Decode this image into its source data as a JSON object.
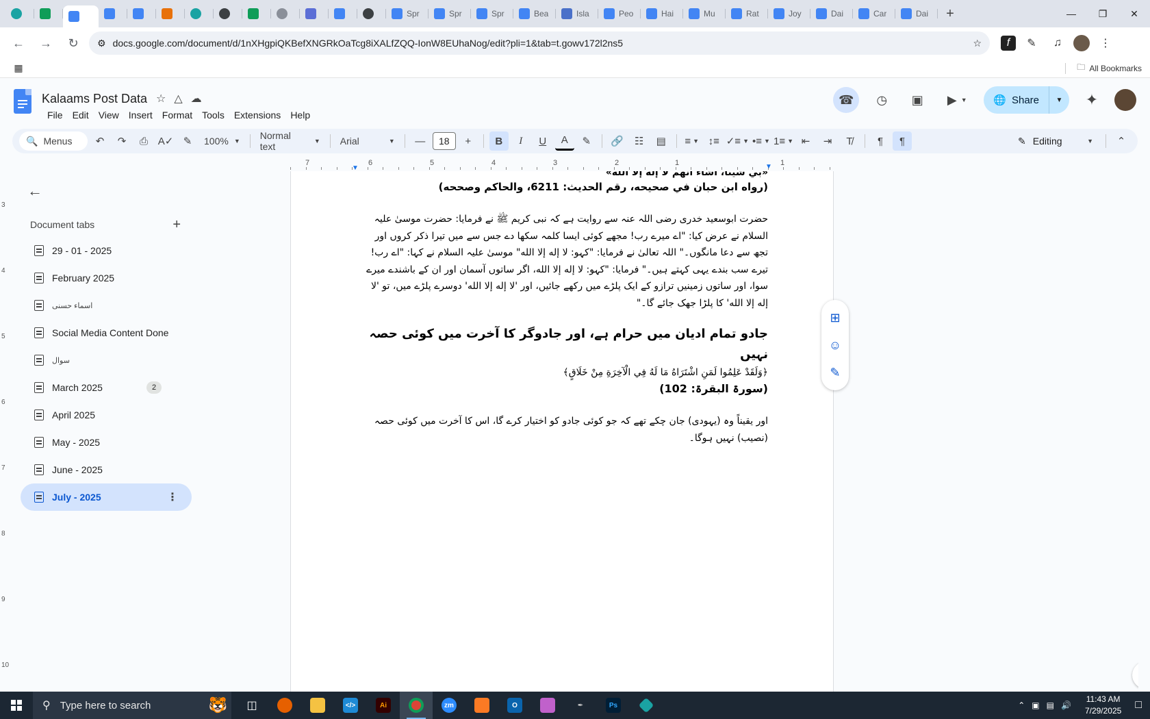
{
  "browser": {
    "tabs": [
      {
        "icon": "vpn-icon",
        "title": "",
        "type": "fav-teal"
      },
      {
        "icon": "sheets-icon",
        "title": "",
        "type": "fav-sheet"
      },
      {
        "icon": "docs-icon",
        "title": "",
        "type": "fav-doc",
        "active": true
      },
      {
        "icon": "docs-icon",
        "title": "",
        "type": "fav-doc"
      },
      {
        "icon": "docs-icon",
        "title": "",
        "type": "fav-doc"
      },
      {
        "icon": "xampp-icon",
        "title": "",
        "type": "fav-orange"
      },
      {
        "icon": "app-icon",
        "title": "",
        "type": "fav-teal"
      },
      {
        "icon": "openai-icon",
        "title": "",
        "type": "fav-dark"
      },
      {
        "icon": "sheets-icon",
        "title": "",
        "type": "fav-sheet"
      },
      {
        "icon": "globe-icon",
        "title": "",
        "type": "fav-grey"
      },
      {
        "icon": "grid-icon",
        "title": "",
        "type": "fav-purple"
      },
      {
        "icon": "docs-icon",
        "title": "",
        "type": "fav-doc"
      },
      {
        "icon": "speaker-icon",
        "title": "",
        "type": "fav-dark"
      },
      {
        "icon": "docs-icon",
        "title": "Spr",
        "type": "fav-doc"
      },
      {
        "icon": "docs-icon",
        "title": "Spr",
        "type": "fav-doc"
      },
      {
        "icon": "docs-icon",
        "title": "Spr",
        "type": "fav-doc"
      },
      {
        "icon": "docs-icon",
        "title": "Bea",
        "type": "fav-doc"
      },
      {
        "icon": "docs-icon",
        "title": "Isla",
        "type": "fav-isla"
      },
      {
        "icon": "docs-icon",
        "title": "Peo",
        "type": "fav-doc"
      },
      {
        "icon": "docs-icon",
        "title": "Hai",
        "type": "fav-doc"
      },
      {
        "icon": "docs-icon",
        "title": "Mu",
        "type": "fav-doc"
      },
      {
        "icon": "docs-icon",
        "title": "Rat",
        "type": "fav-doc"
      },
      {
        "icon": "docs-icon",
        "title": "Joy",
        "type": "fav-doc"
      },
      {
        "icon": "docs-icon",
        "title": "Dai",
        "type": "fav-doc"
      },
      {
        "icon": "docs-icon",
        "title": "Car",
        "type": "fav-doc"
      },
      {
        "icon": "docs-icon",
        "title": "Dai",
        "type": "fav-doc"
      }
    ],
    "new_tab": "+",
    "url": "docs.google.com/document/d/1nXHgpiQKBefXNGRkOaTcg8iXALfZQQ-IonW8EUhaNog/edit?pli=1&tab=t.gowv172l2ns5",
    "all_bookmarks": "All Bookmarks"
  },
  "docs": {
    "title": "Kalaams Post Data",
    "menus": [
      "File",
      "Edit",
      "View",
      "Insert",
      "Format",
      "Tools",
      "Extensions",
      "Help"
    ],
    "share": "Share",
    "toolbar": {
      "search": "Menus",
      "zoom": "100%",
      "style": "Normal text",
      "font": "Arial",
      "font_size": "18",
      "mode": "Editing"
    }
  },
  "ruler": {
    "labels": [
      "7",
      "6",
      "5",
      "4",
      "3",
      "2",
      "1",
      "1"
    ]
  },
  "vruler": {
    "labels": [
      "3",
      "4",
      "5",
      "6",
      "7",
      "8",
      "9",
      "10"
    ]
  },
  "sidebar": {
    "heading": "Document tabs",
    "tabs": [
      {
        "label": "29 - 01 - 2025"
      },
      {
        "label": "February 2025"
      },
      {
        "label": "اسماء حسنی",
        "urdu": true
      },
      {
        "label": "Social Media Content Done"
      },
      {
        "label": "سوال",
        "urdu": true
      },
      {
        "label": "March 2025",
        "badge": "2"
      },
      {
        "label": "April 2025"
      },
      {
        "label": "May - 2025"
      },
      {
        "label": "June - 2025"
      },
      {
        "label": "July - 2025",
        "selected": true
      }
    ]
  },
  "document": {
    "cut_line": "«بي شيئًا، أشاء أنهم لا إله إلا الله»",
    "reference1": "(رواه ابن حبان في صحيحه، رقم الحديث: 6211، والحاكم وصححه)",
    "paragraph1": "حضرت ابوسعید خدری رضی اللہ عنہ سے روایت ہے کہ نبی کریم ﷺ نے فرمایا: حضرت موسیٰ علیہ السلام نے عرض کیا: \"اے میرے رب! مجھے کوئی ایسا کلمہ سکھا دے جس سے میں تیرا ذکر کروں اور تجھ سے دعا مانگوں۔\" اللہ تعالیٰ نے فرمایا: \"کہو: لا إله إلا الله\" موسیٰ علیہ السلام نے کہا: \"اے رب! تیرے سب بندے یہی کہتے ہیں۔\" فرمایا: \"کہو: لا إله إلا الله، اگر ساتوں آسمان اور ان کے باشندے میرے سوا، اور ساتوں زمینیں ترازو کے ایک پلڑے میں رکھے جائیں، اور 'لا إله إلا الله' دوسرے پلڑے میں، تو 'لا إله إلا الله' کا پلڑا جھک جائے گا۔\"",
    "heading": "جادو تمام ادیان میں حرام ہے، اور جادوگر کا آخرت میں کوئی حصہ نہیں",
    "verse": "﴿وَلَقَدْ عَلِمُوا لَمَنِ اشْتَرَاهُ مَا لَهُ فِي الْآخِرَةِ مِنْ خَلَاقٍ﴾",
    "reference2": "(سورۃ البقرۃ: 102)",
    "translation": "اور یقیناً وہ (یہودی) جان چکے تھے کہ جو کوئی جادو کو اختیار کرے گا، اس کا آخرت میں کوئی حصہ (نصیب) نہیں ہوگا۔"
  },
  "taskbar": {
    "search_placeholder": "Type here to search",
    "time": "11:43 AM",
    "date": "7/29/2025"
  }
}
